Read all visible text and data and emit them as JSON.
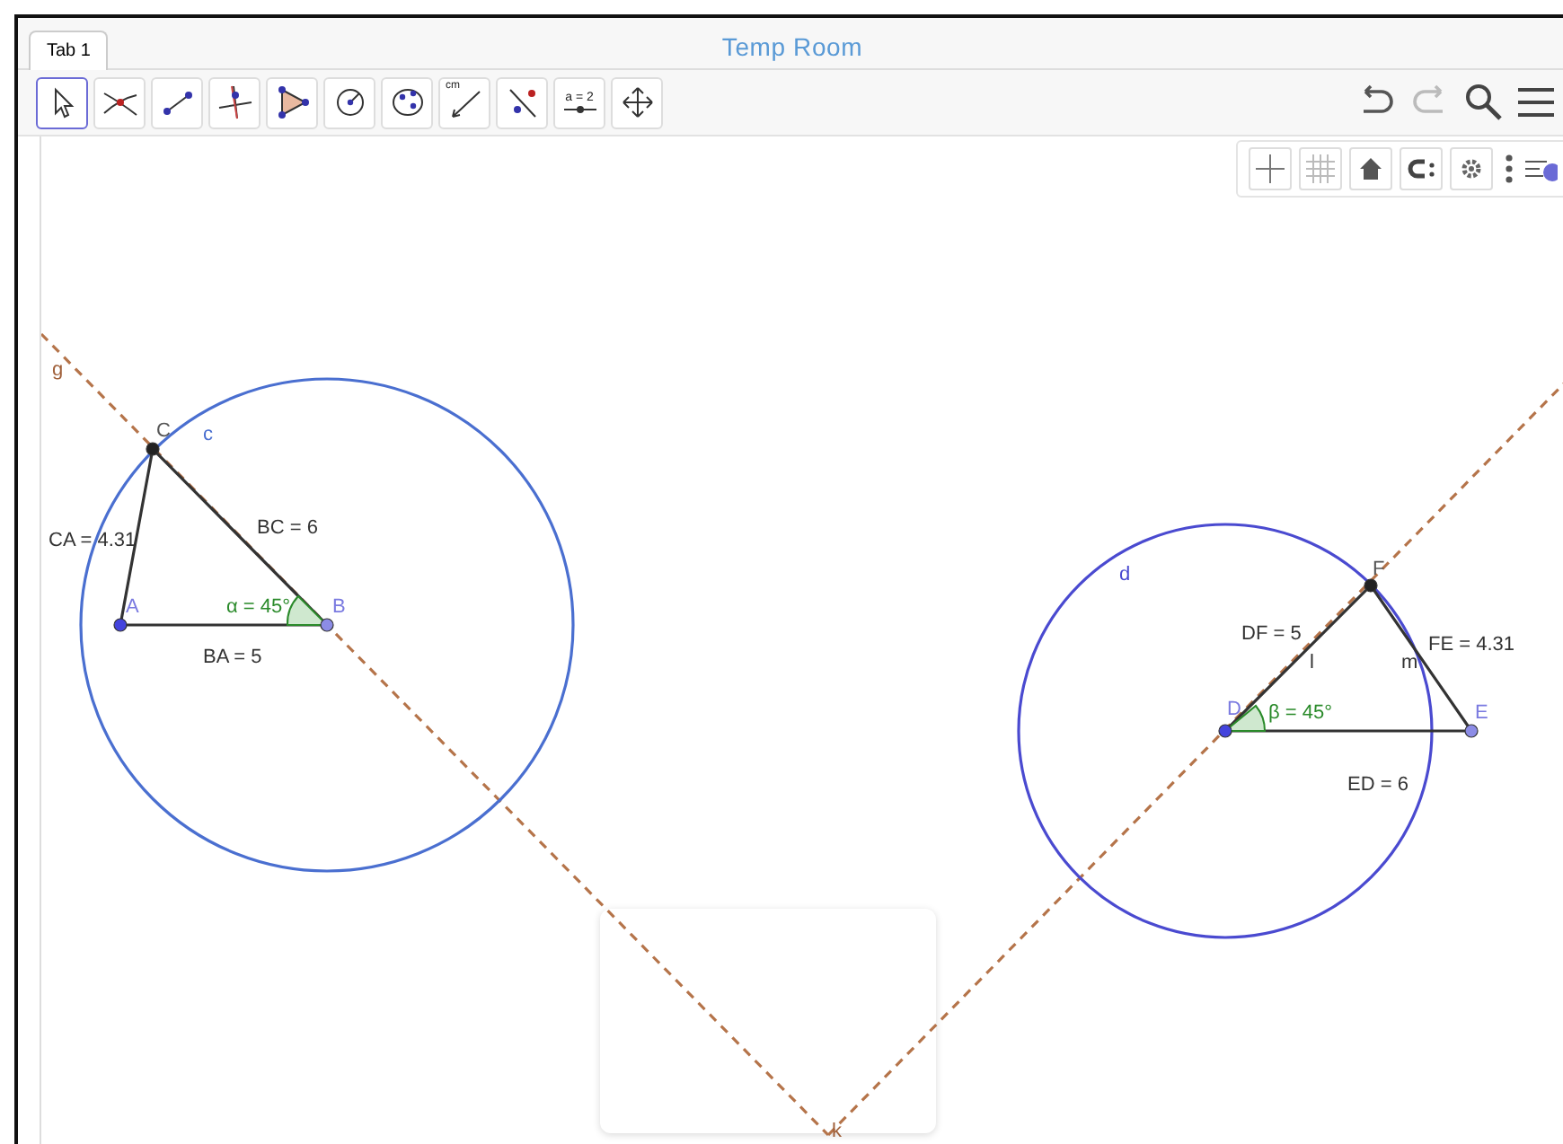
{
  "tab": {
    "label": "Tab 1",
    "selected": true
  },
  "title": "Temp Room",
  "tools": [
    {
      "kind": "move",
      "selected": true
    },
    {
      "kind": "intersect",
      "selected": false
    },
    {
      "kind": "segment",
      "selected": false
    },
    {
      "kind": "perpendicular",
      "selected": false
    },
    {
      "kind": "polygon",
      "selected": false
    },
    {
      "kind": "circle",
      "selected": false
    },
    {
      "kind": "conic",
      "selected": false
    },
    {
      "kind": "measure",
      "text": "cm",
      "selected": false
    },
    {
      "kind": "reflect",
      "selected": false
    },
    {
      "kind": "slider",
      "text": "a = 2",
      "selected": false
    },
    {
      "kind": "pan",
      "selected": false
    }
  ],
  "canvas": {
    "lines": [
      {
        "label": "g"
      },
      {
        "label": "k"
      }
    ],
    "circles": [
      {
        "label": "c"
      },
      {
        "label": "d"
      }
    ],
    "points": [
      {
        "label": "A",
        "color": "#4444dd"
      },
      {
        "label": "B",
        "color": "#8c8ce6"
      },
      {
        "label": "C",
        "color": "#222222"
      },
      {
        "label": "D",
        "color": "#4444dd"
      },
      {
        "label": "E",
        "color": "#8c8ce6"
      },
      {
        "label": "F",
        "color": "#222222"
      }
    ],
    "segment_labels": [
      {
        "text": "CA = 4.31"
      },
      {
        "text": "BC = 6"
      },
      {
        "text": "BA = 5"
      },
      {
        "text": "DF = 5"
      },
      {
        "text": "l"
      },
      {
        "text": "FE = 4.31"
      },
      {
        "text": "m"
      },
      {
        "text": "ED = 6"
      }
    ],
    "angles": [
      {
        "text": "α = 45°"
      },
      {
        "text": "β = 45°"
      }
    ]
  }
}
